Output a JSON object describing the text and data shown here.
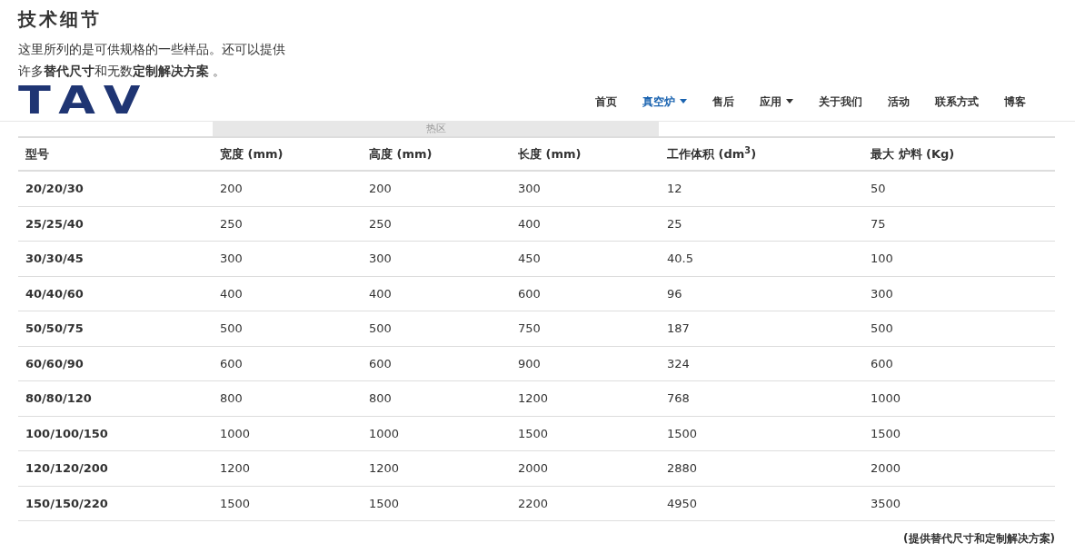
{
  "heading": "技术细节",
  "intro": [
    "这里所列的是可供规格的一些样品。还可以提供",
    "许多**替代尺寸**和无数**定制解决方案** 。"
  ],
  "logo": "TAV",
  "nav": [
    {
      "label": "首页",
      "selected": false,
      "dropdown": false
    },
    {
      "label": "真空炉",
      "selected": true,
      "dropdown": true
    },
    {
      "label": "售后",
      "selected": false,
      "dropdown": false
    },
    {
      "label": "应用",
      "selected": false,
      "dropdown": true
    },
    {
      "label": "关于我们",
      "selected": false,
      "dropdown": false
    },
    {
      "label": "活动",
      "selected": false,
      "dropdown": false
    },
    {
      "label": "联系方式",
      "selected": false,
      "dropdown": false
    },
    {
      "label": "博客",
      "selected": false,
      "dropdown": false
    }
  ],
  "hot_zone_tab": "热区",
  "table": {
    "columns": [
      "型号",
      "宽度 (mm)",
      "高度 (mm)",
      "长度 (mm)",
      "工作体积 (dm$^{3}$)",
      "最大 炉料 (Kg)"
    ],
    "rows": [
      [
        "20/20/30",
        "200",
        "200",
        "300",
        "12",
        "50"
      ],
      [
        "25/25/40",
        "250",
        "250",
        "400",
        "25",
        "75"
      ],
      [
        "30/30/45",
        "300",
        "300",
        "450",
        "40.5",
        "100"
      ],
      [
        "40/40/60",
        "400",
        "400",
        "600",
        "96",
        "300"
      ],
      [
        "50/50/75",
        "500",
        "500",
        "750",
        "187",
        "500"
      ],
      [
        "60/60/90",
        "600",
        "600",
        "900",
        "324",
        "600"
      ],
      [
        "80/80/120",
        "800",
        "800",
        "1200",
        "768",
        "1000"
      ],
      [
        "100/100/150",
        "1000",
        "1000",
        "1500",
        "1500",
        "1500"
      ],
      [
        "120/120/200",
        "1200",
        "1200",
        "2000",
        "2880",
        "2000"
      ],
      [
        "150/150/220",
        "1500",
        "1500",
        "2200",
        "4950",
        "3500"
      ]
    ]
  },
  "footnote": "(提供替代尺寸和定制解决方案)"
}
